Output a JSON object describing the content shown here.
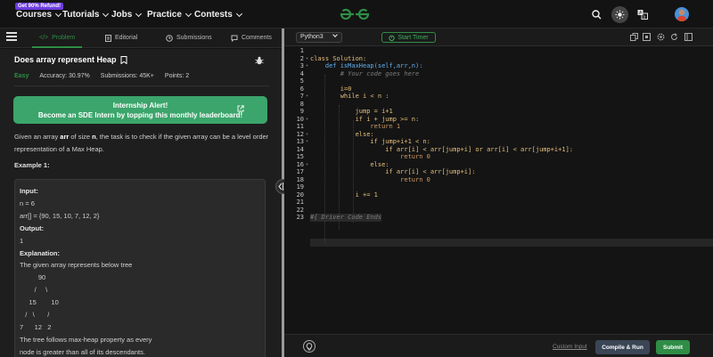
{
  "nav": {
    "promo": "Get 90% Refund!",
    "menus": [
      "Courses",
      "Tutorials",
      "Jobs",
      "Practice",
      "Contests"
    ],
    "logo": "GfG"
  },
  "tabs": [
    {
      "label": "Problem",
      "icon": "code-icon",
      "active": true
    },
    {
      "label": "Editorial",
      "icon": "document-icon",
      "active": false
    },
    {
      "label": "Submissions",
      "icon": "clock-icon",
      "active": false
    },
    {
      "label": "Comments",
      "icon": "chat-icon",
      "active": false
    }
  ],
  "problem": {
    "title": "Does array represent Heap",
    "difficulty": "Easy",
    "accuracy_label": "Accuracy: 30.97%",
    "submissions_label": "Submissions: 45K+",
    "points_label": "Points: 2"
  },
  "alert": {
    "line1": "Internship Alert!",
    "line2": "Become an SDE Intern by topping this monthly leaderboard!"
  },
  "description": {
    "part1": "Given an array ",
    "arr": "arr",
    "part2": " of size ",
    "n": "n",
    "part3": ", the task is to check if the given array can be a level order representation of a Max Heap."
  },
  "example": {
    "heading": "Example 1:",
    "input_label": "Input:",
    "n_line": "n  =  6",
    "arr_line": "arr[]  =  {90,  15,  10,  7,  12,  2}",
    "output_label": "Output:",
    "output_value": "1",
    "explanation_label": "Explanation:",
    "explanation_line": "The  given  array  represents  below  tree",
    "tree": "          90\n        /     \\\n     15        10\n   /   \\       /\n7      12   2",
    "trailing_1": "The  tree  follows  max-heap  property  as  every",
    "trailing_2": "node  is  greater  than  all  of  its  descendants."
  },
  "editor": {
    "language": "Python3",
    "timer_label": "Start Timer",
    "custom_input_label": "Custom Input",
    "compile_label": "Compile & Run",
    "submit_label": "Submit",
    "line_numbers": [
      "1",
      "2",
      "3",
      "4",
      "5",
      "6",
      "7",
      "8",
      "9",
      "10",
      "11",
      "12",
      "13",
      "14",
      "15",
      "16",
      "17",
      "18",
      "19",
      "20",
      "21",
      "22",
      "23"
    ],
    "code": [
      "",
      "class Solution:",
      "    def isMaxHeap(self,arr,n):",
      "        # Your code goes here",
      "",
      "        i=0",
      "        while i < n :",
      "",
      "            jump = i+1",
      "            if i + jump >= n:",
      "                return 1",
      "            else:",
      "                if jump+i+1 < n:",
      "                    if arr[i] < arr[jump+i] or arr[i] < arr[jump+i+1]:",
      "                        return 0",
      "                else:",
      "                    if arr[i] < arr[jump+i]:",
      "                        return 0",
      "",
      "            i += 1",
      "",
      "",
      "#{ Driver Code Ends"
    ]
  },
  "colors": {
    "accent": "#2f8d46",
    "alert": "#3ba56b",
    "compile": "#3a4656"
  }
}
